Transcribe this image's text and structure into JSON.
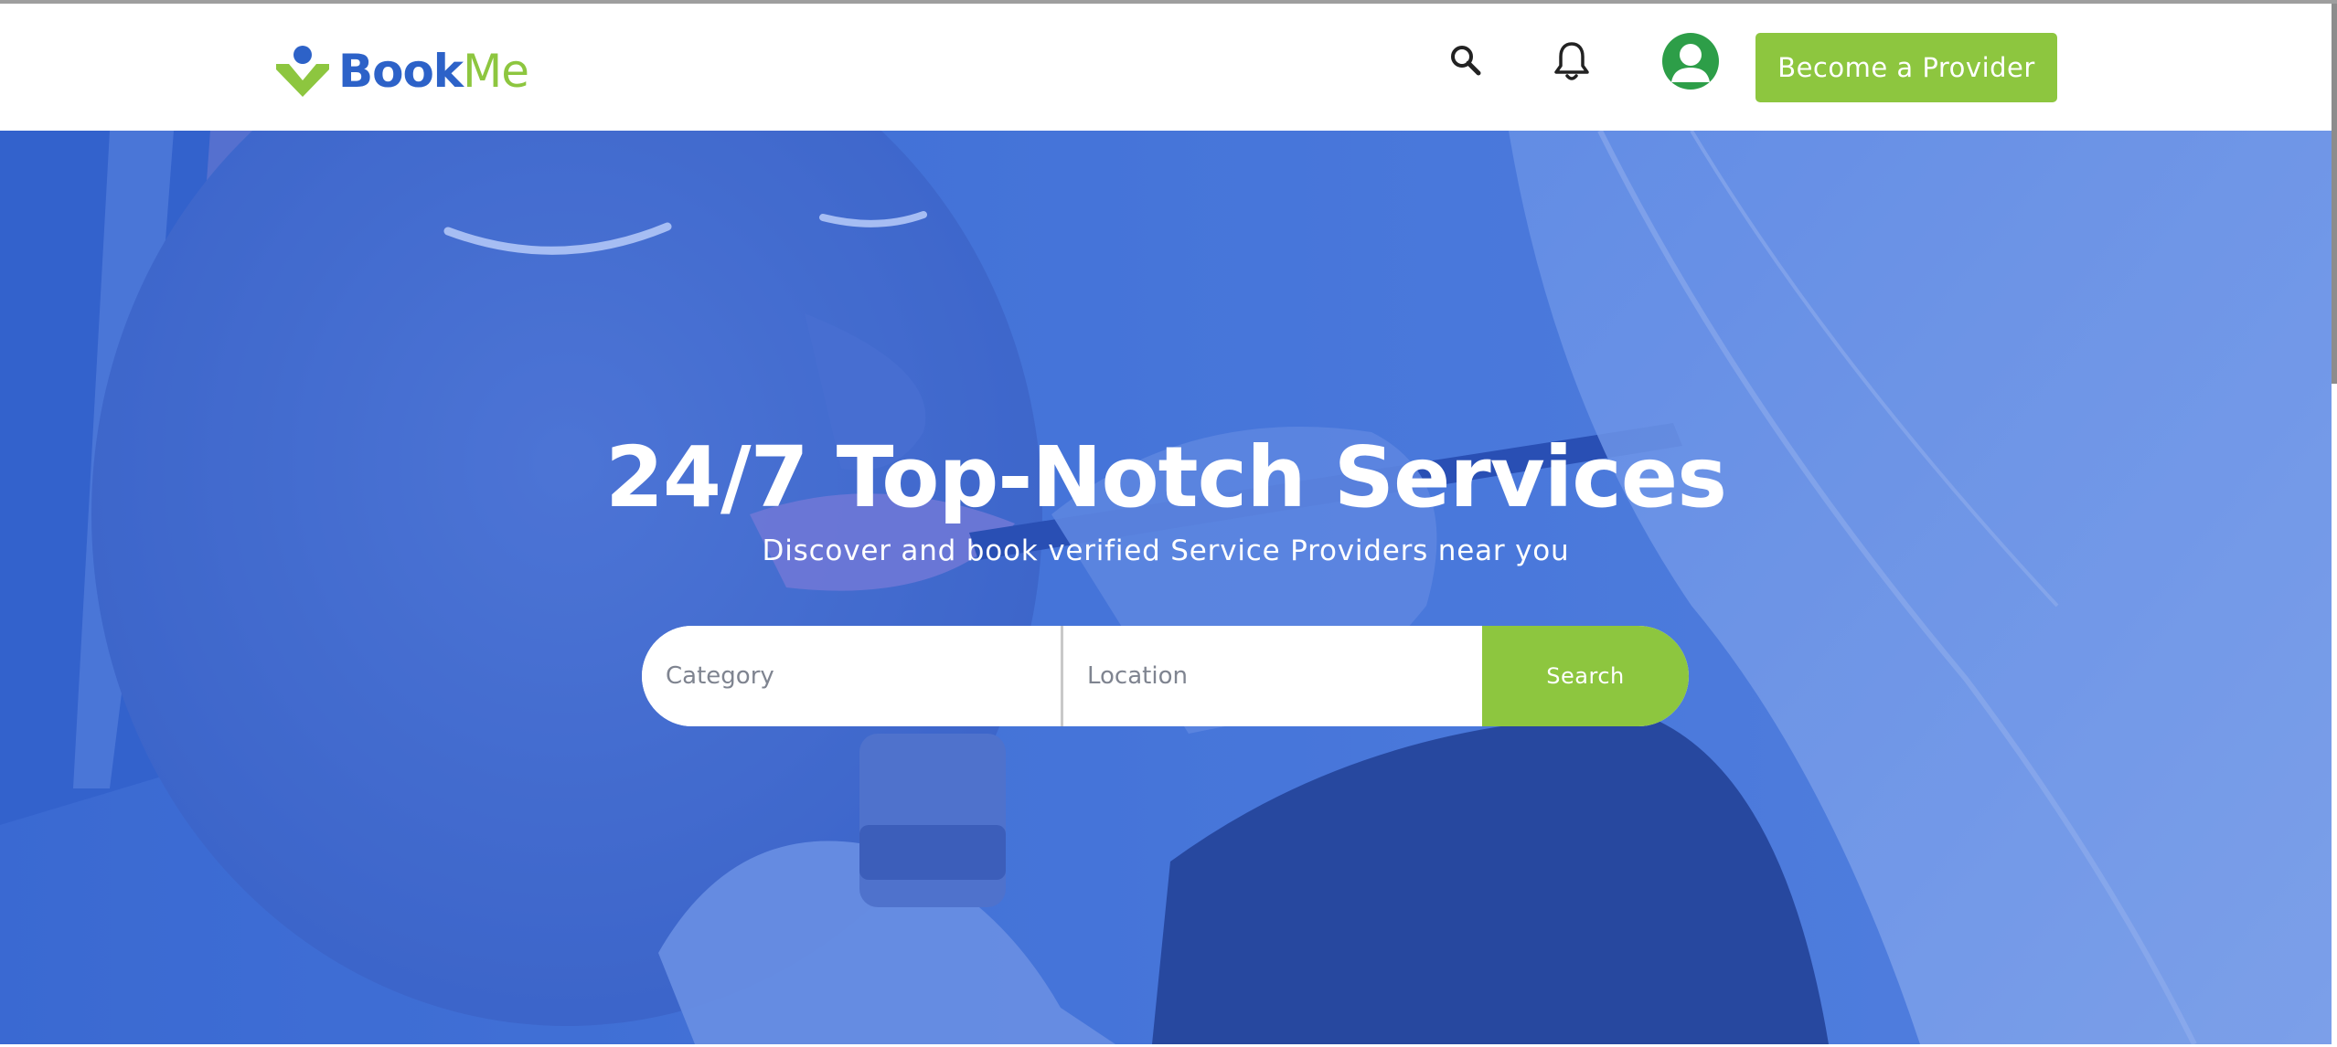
{
  "brand": {
    "name_part1": "Book",
    "name_part2": "Me",
    "color_primary": "#2d62c8",
    "color_accent": "#8dc63f"
  },
  "nav": {
    "search_icon": "search-icon",
    "bell_icon": "bell-icon",
    "avatar_icon": "user-avatar-icon",
    "cta_label": "Become a Provider"
  },
  "hero": {
    "title": "24/7 Top-Notch Services",
    "subtitle": "Discover and book verified Service Providers near you",
    "search": {
      "category_placeholder": "Category",
      "location_placeholder": "Location",
      "button_label": "Search"
    },
    "overlay_color": "#3c6edc"
  }
}
